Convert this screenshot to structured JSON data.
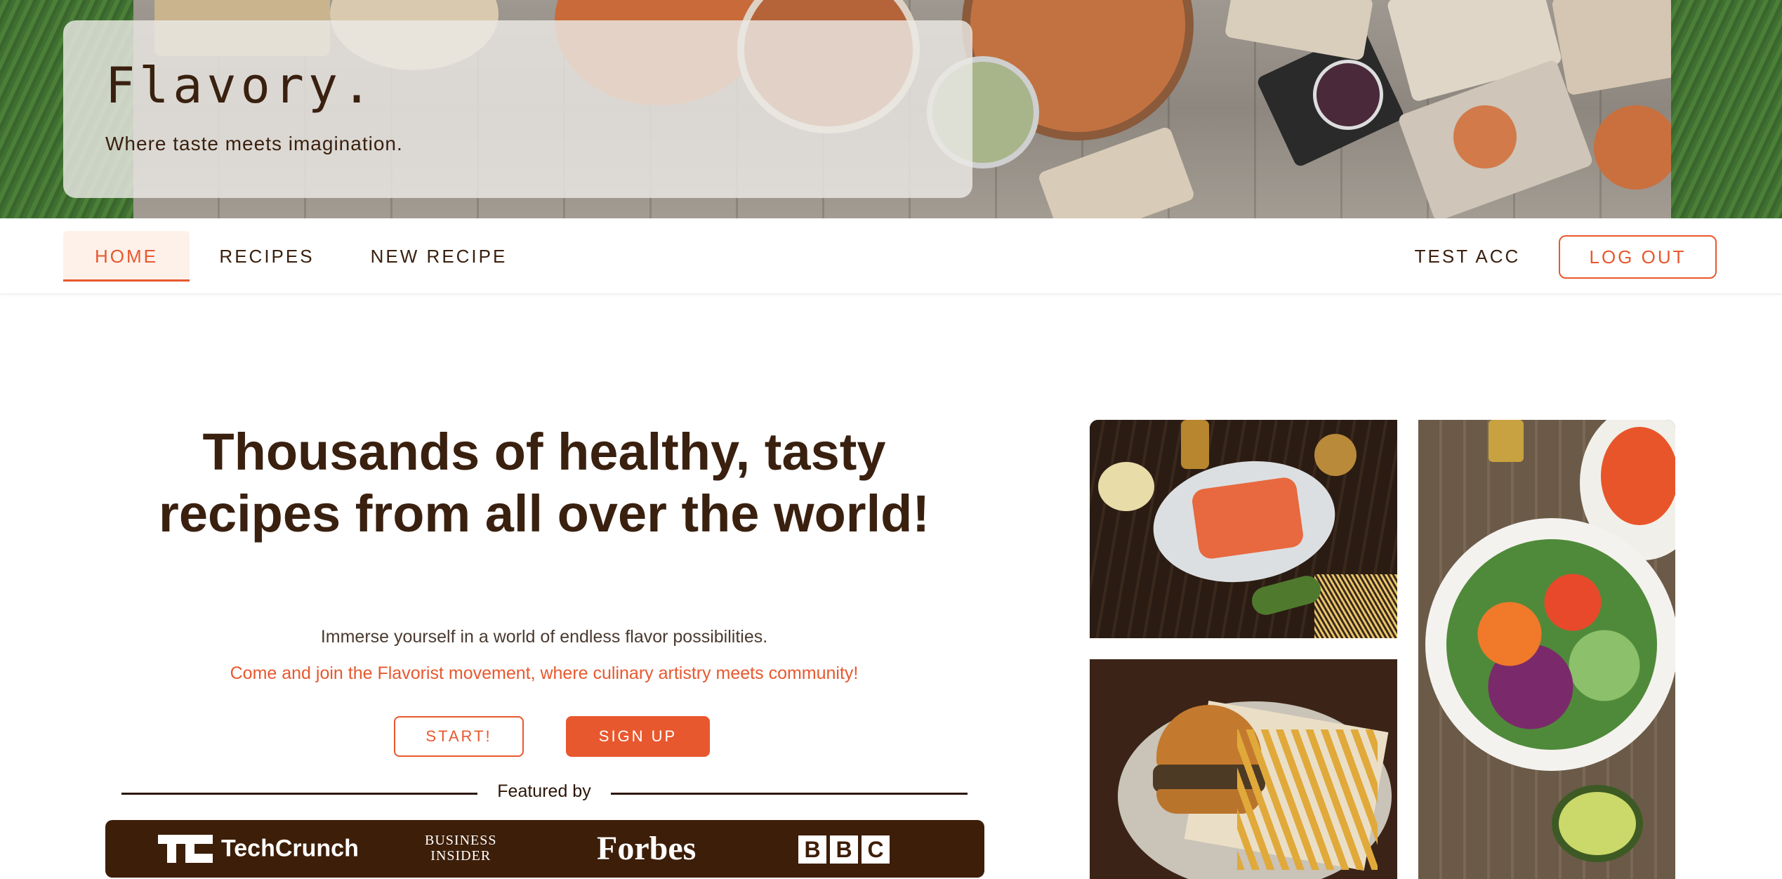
{
  "brand": {
    "title": "Flavory.",
    "subtitle": "Where taste meets imagination."
  },
  "nav": {
    "items": [
      {
        "label": "HOME",
        "active": true
      },
      {
        "label": "RECIPES",
        "active": false
      },
      {
        "label": "NEW RECIPE",
        "active": false
      }
    ],
    "user": "TEST ACC",
    "logout": "LOG OUT"
  },
  "hero": {
    "headline_line1": "Thousands of healthy, tasty",
    "headline_line2": "recipes from all over the world!",
    "tagline": "Immerse yourself in a world of endless flavor possibilities.",
    "invite": "Come and join the Flavorist movement, where culinary artistry meets community!",
    "start_button": "START!",
    "signup_button": "SIGN UP"
  },
  "featured": {
    "label": "Featured by",
    "logos": {
      "techcrunch": "TechCrunch",
      "business_insider_line1": "BUSINESS",
      "business_insider_line2": "INSIDER",
      "forbes": "Forbes",
      "bbc": [
        "B",
        "B",
        "C"
      ]
    }
  },
  "colors": {
    "accent": "#e8582e",
    "brown": "#3a200f",
    "logo_strip": "#3d1e08"
  },
  "icons": {
    "techcrunch": "techcrunch-logo-mark"
  }
}
